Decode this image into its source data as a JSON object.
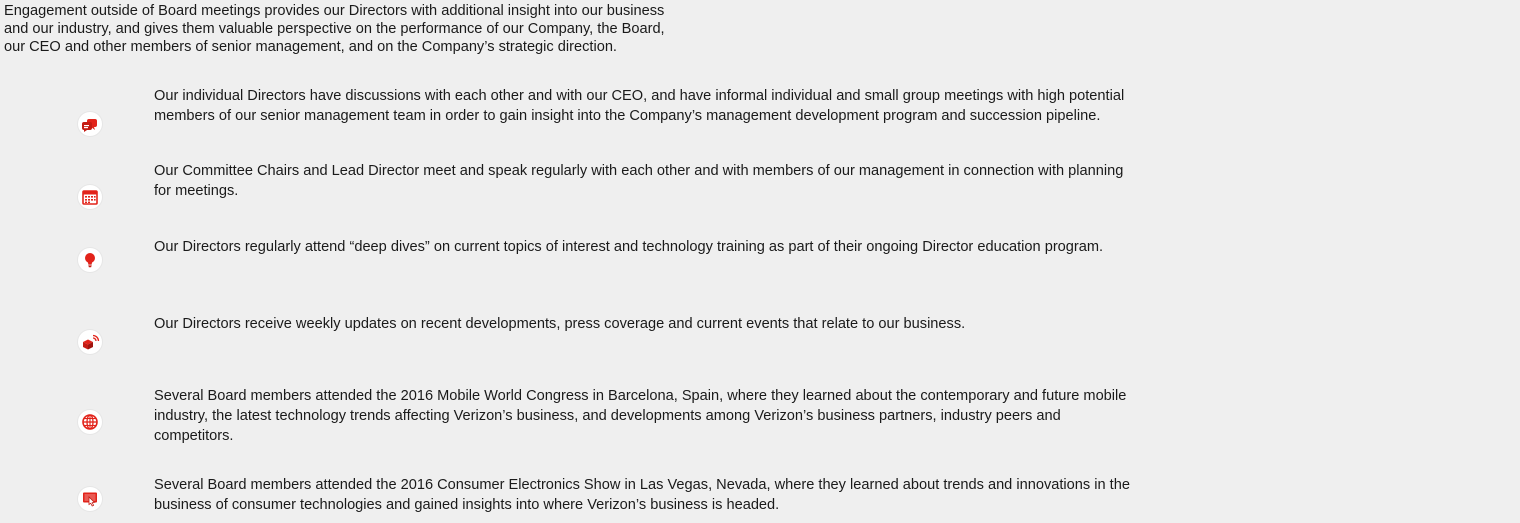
{
  "intro": {
    "lines": [
      "Engagement outside of Board meetings provides our Directors with additional insight into our business",
      "and our industry, and gives them valuable perspective on the performance of our Company, the Board,",
      "our CEO and other members of senior management, and on the Company’s strategic direction."
    ]
  },
  "colors": {
    "icon_accent": "#e2231a",
    "background": "#efefef",
    "text": "#1a1a1a"
  },
  "items": [
    {
      "icon": "chat-bubbles-icon",
      "lines": [
        "Our individual Directors have discussions with each other and with our CEO, and have informal individual and small group meetings with high potential",
        "members of our senior management team in order to gain insight into the Company’s management development program and succession pipeline."
      ]
    },
    {
      "icon": "calendar-icon",
      "lines": [
        "Our Committee Chairs and Lead Director meet and speak regularly with each other and with members of our management in connection with planning",
        "for meetings."
      ]
    },
    {
      "icon": "lightbulb-icon",
      "lines": [
        "Our Directors regularly attend “deep dives” on current topics of interest and technology training as part of their ongoing Director education program."
      ]
    },
    {
      "icon": "broadcast-box-icon",
      "lines": [
        "Our Directors receive weekly updates on recent developments, press coverage and current events that relate to our business."
      ]
    },
    {
      "icon": "globe-icon",
      "lines": [
        "Several Board members attended the 2016 Mobile World Congress in Barcelona, Spain, where they learned about the contemporary and future mobile",
        "industry, the latest technology trends affecting Verizon’s business, and developments among Verizon’s business partners, industry peers and",
        "competitors."
      ]
    },
    {
      "icon": "touch-screen-icon",
      "lines": [
        "Several Board members attended the 2016 Consumer Electronics Show in Las Vegas, Nevada, where they learned about trends and innovations in the",
        "business of consumer technologies and gained insights into where Verizon’s business is headed."
      ]
    }
  ]
}
